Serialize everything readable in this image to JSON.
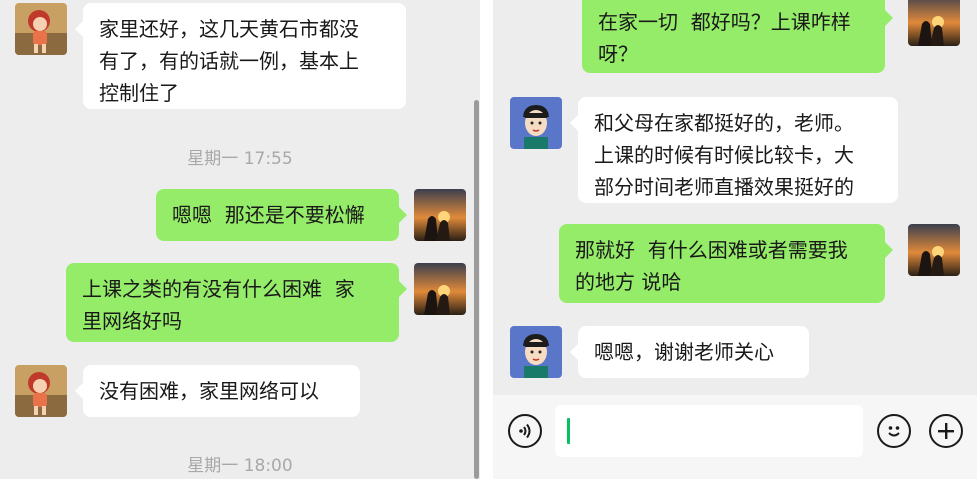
{
  "left_chat": {
    "messages": [
      {
        "sender": "contact",
        "text": "家里还好，这几天黄石市都没\n有了，有的话就一例，基本上\n控制住了"
      },
      {
        "type": "time",
        "text": "星期一 17:55"
      },
      {
        "sender": "me",
        "text": "嗯嗯  那还是不要松懈"
      },
      {
        "sender": "me",
        "text": "上课之类的有没有什么困难  家\n里网络好吗"
      },
      {
        "sender": "contact",
        "text": "没有困难，家里网络可以"
      },
      {
        "type": "time",
        "text": "星期一 18:00"
      }
    ]
  },
  "right_chat": {
    "messages": [
      {
        "sender": "me",
        "text": "在家一切  都好吗？上课咋样\n呀？"
      },
      {
        "sender": "contact",
        "text": "和父母在家都挺好的，老师。\n上课的时候有时候比较卡，大\n部分时间老师直播效果挺好的"
      },
      {
        "sender": "me",
        "text": "那就好  有什么困难或者需要我\n的地方 说哈"
      },
      {
        "sender": "contact",
        "text": "嗯嗯，谢谢老师关心"
      }
    ],
    "input": {
      "value": ""
    }
  },
  "icons": {
    "voice": "voice-icon",
    "emoji": "emoji-icon",
    "plus": "plus-icon"
  },
  "colors": {
    "my_bubble": "#95ec69",
    "their_bubble": "#ffffff",
    "background": "#ededed",
    "cursor": "#07c160"
  }
}
